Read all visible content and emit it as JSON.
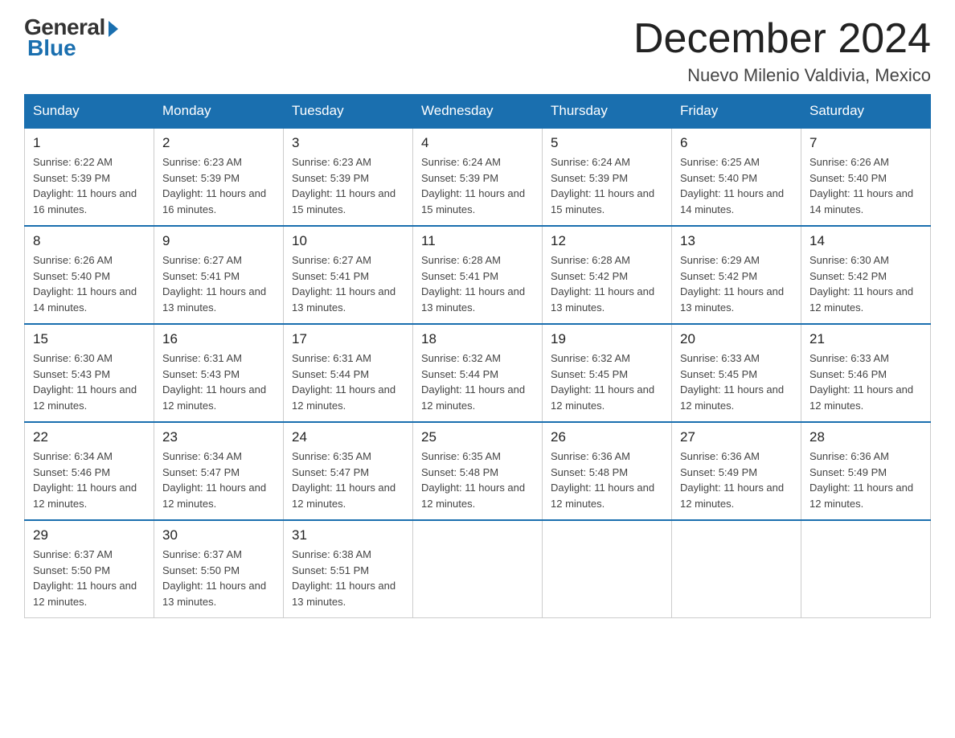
{
  "header": {
    "logo_general": "General",
    "logo_blue": "Blue",
    "month_title": "December 2024",
    "location": "Nuevo Milenio Valdivia, Mexico"
  },
  "days_of_week": [
    "Sunday",
    "Monday",
    "Tuesday",
    "Wednesday",
    "Thursday",
    "Friday",
    "Saturday"
  ],
  "weeks": [
    [
      {
        "day": "1",
        "sunrise": "6:22 AM",
        "sunset": "5:39 PM",
        "daylight": "11 hours and 16 minutes."
      },
      {
        "day": "2",
        "sunrise": "6:23 AM",
        "sunset": "5:39 PM",
        "daylight": "11 hours and 16 minutes."
      },
      {
        "day": "3",
        "sunrise": "6:23 AM",
        "sunset": "5:39 PM",
        "daylight": "11 hours and 15 minutes."
      },
      {
        "day": "4",
        "sunrise": "6:24 AM",
        "sunset": "5:39 PM",
        "daylight": "11 hours and 15 minutes."
      },
      {
        "day": "5",
        "sunrise": "6:24 AM",
        "sunset": "5:39 PM",
        "daylight": "11 hours and 15 minutes."
      },
      {
        "day": "6",
        "sunrise": "6:25 AM",
        "sunset": "5:40 PM",
        "daylight": "11 hours and 14 minutes."
      },
      {
        "day": "7",
        "sunrise": "6:26 AM",
        "sunset": "5:40 PM",
        "daylight": "11 hours and 14 minutes."
      }
    ],
    [
      {
        "day": "8",
        "sunrise": "6:26 AM",
        "sunset": "5:40 PM",
        "daylight": "11 hours and 14 minutes."
      },
      {
        "day": "9",
        "sunrise": "6:27 AM",
        "sunset": "5:41 PM",
        "daylight": "11 hours and 13 minutes."
      },
      {
        "day": "10",
        "sunrise": "6:27 AM",
        "sunset": "5:41 PM",
        "daylight": "11 hours and 13 minutes."
      },
      {
        "day": "11",
        "sunrise": "6:28 AM",
        "sunset": "5:41 PM",
        "daylight": "11 hours and 13 minutes."
      },
      {
        "day": "12",
        "sunrise": "6:28 AM",
        "sunset": "5:42 PM",
        "daylight": "11 hours and 13 minutes."
      },
      {
        "day": "13",
        "sunrise": "6:29 AM",
        "sunset": "5:42 PM",
        "daylight": "11 hours and 13 minutes."
      },
      {
        "day": "14",
        "sunrise": "6:30 AM",
        "sunset": "5:42 PM",
        "daylight": "11 hours and 12 minutes."
      }
    ],
    [
      {
        "day": "15",
        "sunrise": "6:30 AM",
        "sunset": "5:43 PM",
        "daylight": "11 hours and 12 minutes."
      },
      {
        "day": "16",
        "sunrise": "6:31 AM",
        "sunset": "5:43 PM",
        "daylight": "11 hours and 12 minutes."
      },
      {
        "day": "17",
        "sunrise": "6:31 AM",
        "sunset": "5:44 PM",
        "daylight": "11 hours and 12 minutes."
      },
      {
        "day": "18",
        "sunrise": "6:32 AM",
        "sunset": "5:44 PM",
        "daylight": "11 hours and 12 minutes."
      },
      {
        "day": "19",
        "sunrise": "6:32 AM",
        "sunset": "5:45 PM",
        "daylight": "11 hours and 12 minutes."
      },
      {
        "day": "20",
        "sunrise": "6:33 AM",
        "sunset": "5:45 PM",
        "daylight": "11 hours and 12 minutes."
      },
      {
        "day": "21",
        "sunrise": "6:33 AM",
        "sunset": "5:46 PM",
        "daylight": "11 hours and 12 minutes."
      }
    ],
    [
      {
        "day": "22",
        "sunrise": "6:34 AM",
        "sunset": "5:46 PM",
        "daylight": "11 hours and 12 minutes."
      },
      {
        "day": "23",
        "sunrise": "6:34 AM",
        "sunset": "5:47 PM",
        "daylight": "11 hours and 12 minutes."
      },
      {
        "day": "24",
        "sunrise": "6:35 AM",
        "sunset": "5:47 PM",
        "daylight": "11 hours and 12 minutes."
      },
      {
        "day": "25",
        "sunrise": "6:35 AM",
        "sunset": "5:48 PM",
        "daylight": "11 hours and 12 minutes."
      },
      {
        "day": "26",
        "sunrise": "6:36 AM",
        "sunset": "5:48 PM",
        "daylight": "11 hours and 12 minutes."
      },
      {
        "day": "27",
        "sunrise": "6:36 AM",
        "sunset": "5:49 PM",
        "daylight": "11 hours and 12 minutes."
      },
      {
        "day": "28",
        "sunrise": "6:36 AM",
        "sunset": "5:49 PM",
        "daylight": "11 hours and 12 minutes."
      }
    ],
    [
      {
        "day": "29",
        "sunrise": "6:37 AM",
        "sunset": "5:50 PM",
        "daylight": "11 hours and 12 minutes."
      },
      {
        "day": "30",
        "sunrise": "6:37 AM",
        "sunset": "5:50 PM",
        "daylight": "11 hours and 13 minutes."
      },
      {
        "day": "31",
        "sunrise": "6:38 AM",
        "sunset": "5:51 PM",
        "daylight": "11 hours and 13 minutes."
      },
      null,
      null,
      null,
      null
    ]
  ],
  "labels": {
    "sunrise_prefix": "Sunrise: ",
    "sunset_prefix": "Sunset: ",
    "daylight_prefix": "Daylight: "
  }
}
